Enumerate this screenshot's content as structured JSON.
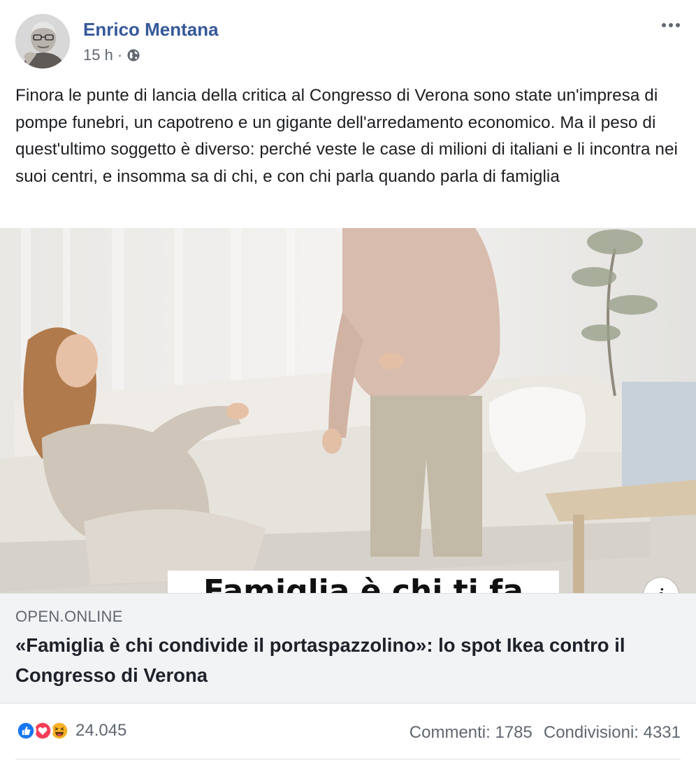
{
  "post": {
    "author": "Enrico Mentana",
    "timestamp": "15 h",
    "separator": "·",
    "privacy_icon": "globe-icon",
    "more_icon": "more-options-icon",
    "text": "Finora le punte di lancia della critica al Congresso di Verona sono state un'impresa di pompe funebri, un capotreno e un gigante dell'arredamento economico. Ma il peso di quest'ultimo soggetto è diverso: perché veste le case di milioni di italiani e li incontra nei suoi centri, e insomma sa di chi, e con chi parla quando parla di famiglia"
  },
  "link": {
    "image_caption": "Famiglia è chi ti fa",
    "domain": "OPEN.ONLINE",
    "title": "«Famiglia è chi condivide il portaspazzolino»: lo spot Ikea contro il Congresso di Verona",
    "info_label": "i"
  },
  "stats": {
    "reactions_count": "24.045",
    "reaction_icons": [
      "like-icon",
      "love-icon",
      "haha-icon"
    ],
    "comments": "Commenti: 1785",
    "shares": "Condivisioni: 4331"
  },
  "colors": {
    "author_link": "#365899",
    "like_blue": "#1877f2",
    "love_red": "#f33e58",
    "haha_yellow": "#f7b125"
  }
}
